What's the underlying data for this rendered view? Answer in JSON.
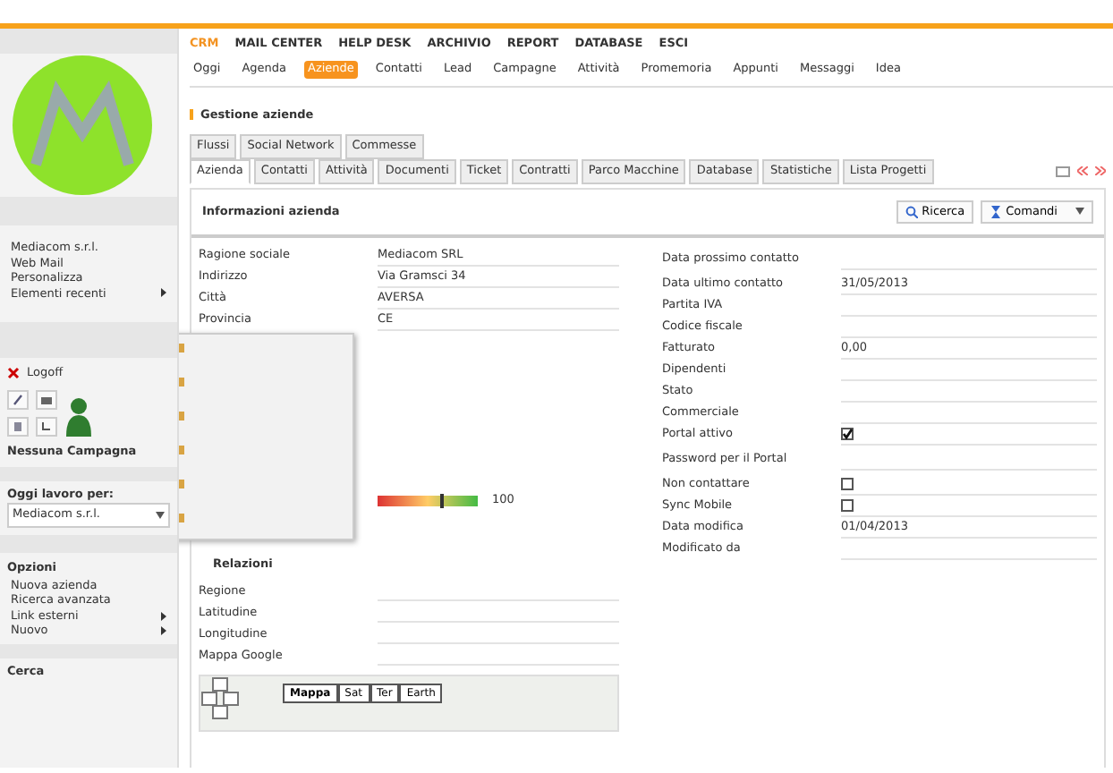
{
  "top_menu": [
    {
      "label": "CRM",
      "selected": true
    },
    {
      "label": "MAIL CENTER",
      "selected": false
    },
    {
      "label": "HELP DESK",
      "selected": false
    },
    {
      "label": "ARCHIVIO",
      "selected": false
    },
    {
      "label": "REPORT",
      "selected": false
    },
    {
      "label": "DATABASE",
      "selected": false
    },
    {
      "label": "ESCI",
      "selected": false
    }
  ],
  "sub_menu": [
    {
      "label": "Oggi",
      "selected": false
    },
    {
      "label": "Agenda",
      "selected": false
    },
    {
      "label": "Aziende",
      "selected": true
    },
    {
      "label": "Contatti",
      "selected": false
    },
    {
      "label": "Lead",
      "selected": false
    },
    {
      "label": "Campagne",
      "selected": false
    },
    {
      "label": "Attività",
      "selected": false
    },
    {
      "label": "Promemoria",
      "selected": false
    },
    {
      "label": "Appunti",
      "selected": false
    },
    {
      "label": "Messaggi",
      "selected": false
    },
    {
      "label": "Idea",
      "selected": false
    }
  ],
  "sidebar": {
    "links": [
      "Mediacom s.r.l.",
      "Web Mail",
      "Personalizza"
    ],
    "recent": "Elementi recenti",
    "logoff": "Logoff",
    "campaign": "Nessuna Campagna",
    "work_for_label": "Oggi lavoro per:",
    "work_for_value": "Mediacom s.r.l.",
    "options_title": "Opzioni",
    "options": [
      {
        "label": "Nuova azienda",
        "submenu": false
      },
      {
        "label": "Ricerca avanzata",
        "submenu": false
      },
      {
        "label": "Link esterni",
        "submenu": true
      },
      {
        "label": "Nuovo",
        "submenu": true
      }
    ],
    "search_title": "Cerca"
  },
  "page_title": "Gestione aziende",
  "tabs_row1": [
    {
      "label": "Flussi",
      "selected": false
    },
    {
      "label": "Social Network",
      "selected": false
    },
    {
      "label": "Commesse",
      "selected": false
    }
  ],
  "tabs_row2": [
    {
      "label": "Azienda",
      "selected": true
    },
    {
      "label": "Contatti",
      "selected": false
    },
    {
      "label": "Attività",
      "selected": false
    },
    {
      "label": "Documenti",
      "selected": false
    },
    {
      "label": "Ticket",
      "selected": false
    },
    {
      "label": "Contratti",
      "selected": false
    },
    {
      "label": "Parco Macchine",
      "selected": false
    },
    {
      "label": "Database",
      "selected": false
    },
    {
      "label": "Statistiche",
      "selected": false
    },
    {
      "label": "Lista Progetti",
      "selected": false
    }
  ],
  "panel": {
    "title": "Informazioni azienda",
    "buttons": [
      {
        "label": "Ricerca",
        "kind": "search"
      },
      {
        "label": "Comandi",
        "kind": "menu"
      }
    ]
  },
  "left_fields": [
    {
      "label": "Ragione sociale",
      "value": "Mediacom SRL"
    },
    {
      "label": "Indirizzo",
      "value": "Via Gramsci 34"
    },
    {
      "label": "Città",
      "value": "AVERSA"
    },
    {
      "label": "Provincia",
      "value": "CE"
    }
  ],
  "rating": {
    "level": 0.62,
    "reading": "100"
  },
  "relations": {
    "title": "Relazioni",
    "fields": [
      {
        "label": "Regione"
      },
      {
        "label": "Latitudine"
      },
      {
        "label": "Longitudine"
      },
      {
        "label": "Mappa Google"
      }
    ]
  },
  "map": {
    "buttons": [
      {
        "label": "Mappa",
        "selected": true
      },
      {
        "label": "Sat",
        "selected": false
      },
      {
        "label": "Ter",
        "selected": false
      },
      {
        "label": "Earth",
        "selected": false
      }
    ]
  },
  "right_fields": [
    {
      "label": "Data prossimo contatto",
      "kind": "text"
    },
    {
      "label": "Data ultimo contatto",
      "kind": "text",
      "value": "31/05/2013"
    },
    {
      "label": "Partita IVA",
      "kind": "text"
    },
    {
      "label": "Codice fiscale",
      "kind": "text"
    },
    {
      "label": "Fatturato",
      "kind": "text",
      "value": "0,00"
    },
    {
      "label": "Dipendenti",
      "kind": "text"
    },
    {
      "label": "Stato",
      "kind": "text"
    },
    {
      "label": "Commerciale",
      "kind": "text"
    },
    {
      "label": "Portal attivo",
      "kind": "check",
      "checked": true
    },
    {
      "label": "Password per il Portal",
      "kind": "text"
    },
    {
      "label": "Non contattare",
      "kind": "check",
      "checked": false
    },
    {
      "label": "Sync Mobile",
      "kind": "check",
      "checked": false
    },
    {
      "label": "Data modifica",
      "kind": "text",
      "value": "01/04/2013"
    },
    {
      "label": "Modificato da",
      "kind": "text"
    }
  ]
}
